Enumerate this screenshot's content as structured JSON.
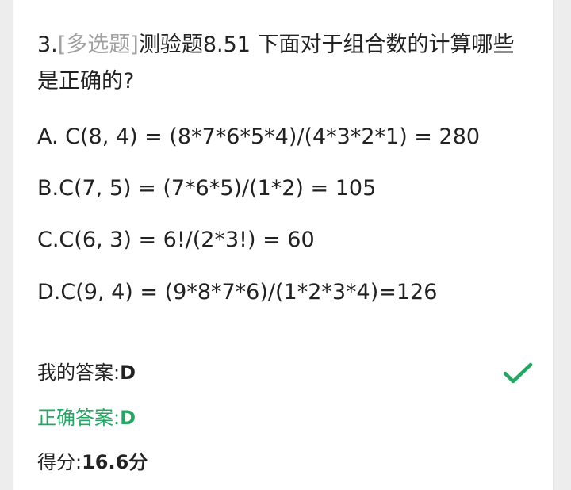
{
  "question": {
    "number": "3.",
    "type": "[多选题]",
    "text": "测验题8.51 下面对于组合数的计算哪些是正确的?"
  },
  "options": [
    {
      "key": "A",
      "text": "A. C(8, 4) = (8*7*6*5*4)/(4*3*2*1) = 280"
    },
    {
      "key": "B",
      "text": "B.C(7, 5) = (7*6*5)/(1*2) = 105"
    },
    {
      "key": "C",
      "text": "C.C(6, 3) = 6!/(2*3!) = 60"
    },
    {
      "key": "D",
      "text": "D.C(9, 4) = (9*8*7*6)/(1*2*3*4)=126"
    }
  ],
  "result": {
    "my_answer_label": "我的答案:",
    "my_answer_value": "D",
    "correct_answer_label": "正确答案:",
    "correct_answer_value": "D",
    "score_label": "得分:",
    "score_value": "16.6分",
    "status_icon": "check-icon"
  },
  "colors": {
    "correct_green": "#22a862",
    "question_type_gray": "#a0a0a0",
    "text": "#222222",
    "page_background": "#ededed",
    "card_background": "#ffffff"
  }
}
